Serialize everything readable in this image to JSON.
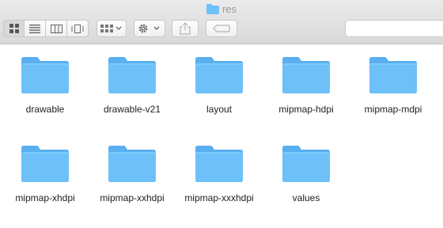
{
  "window": {
    "title": "res"
  },
  "toolbar": {
    "view_buttons": [
      "icon-view-icon",
      "list-view-icon",
      "column-view-icon",
      "cover-flow-icon"
    ],
    "group_icon": "group-grid-icon",
    "action_icon": "gear-icon",
    "share_icon": "share-icon",
    "tag_icon": "tag-icon"
  },
  "colors": {
    "folder": "#6dc1f8",
    "folder_tab": "#5aaff0"
  },
  "files": [
    {
      "name": "drawable"
    },
    {
      "name": "drawable-v21"
    },
    {
      "name": "layout"
    },
    {
      "name": "mipmap-hdpi"
    },
    {
      "name": "mipmap-mdpi"
    },
    {
      "name": "mipmap-xhdpi"
    },
    {
      "name": "mipmap-xxhdpi"
    },
    {
      "name": "mipmap-xxxhdpi"
    },
    {
      "name": "values"
    }
  ]
}
